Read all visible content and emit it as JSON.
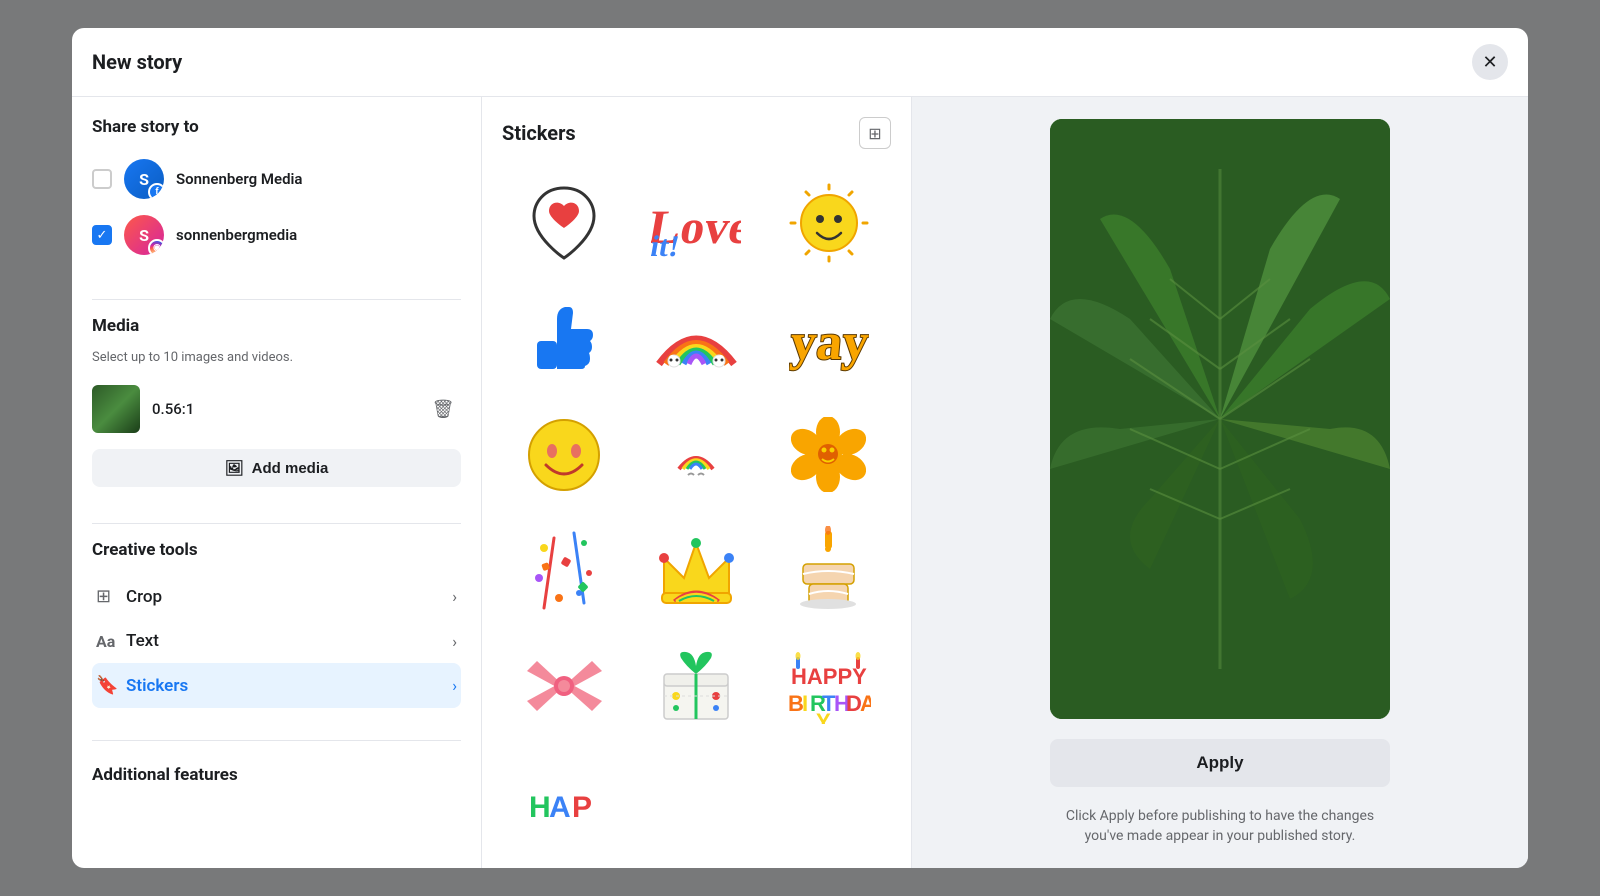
{
  "modal": {
    "title": "New story",
    "close_icon": "✕"
  },
  "share_section": {
    "label": "Share story to",
    "accounts": [
      {
        "id": "sonnenberg",
        "name": "Sonnenberg Media",
        "platform": "fb",
        "checked": false,
        "initial": "S"
      },
      {
        "id": "sonnenbergmedia",
        "name": "sonnenbergmedia",
        "platform": "ig",
        "checked": true,
        "initial": "S"
      }
    ]
  },
  "media_section": {
    "label": "Media",
    "subtitle": "Select up to 10 images and videos.",
    "ratio": "0.56:1",
    "add_media_label": "Add media"
  },
  "creative_tools": {
    "label": "Creative tools",
    "tools": [
      {
        "id": "crop",
        "icon": "crop",
        "label": "Crop",
        "active": false
      },
      {
        "id": "text",
        "icon": "text",
        "label": "Text",
        "active": false
      },
      {
        "id": "stickers",
        "icon": "sticker",
        "label": "Stickers",
        "active": true
      }
    ]
  },
  "additional": {
    "label": "Additional features"
  },
  "stickers": {
    "title": "Stickers",
    "items": [
      {
        "id": "heart-pin",
        "emoji": "📍"
      },
      {
        "id": "love-it",
        "emoji": "💕"
      },
      {
        "id": "happy-sun",
        "emoji": "☀️"
      },
      {
        "id": "thumbs-up",
        "emoji": "👍"
      },
      {
        "id": "rainbow",
        "emoji": "🌈"
      },
      {
        "id": "yay",
        "emoji": "🎉"
      },
      {
        "id": "smiley",
        "emoji": "😊"
      },
      {
        "id": "cloud-rainbow",
        "emoji": "⛅"
      },
      {
        "id": "flower",
        "emoji": "🌸"
      },
      {
        "id": "confetti",
        "emoji": "🎊"
      },
      {
        "id": "crown",
        "emoji": "👑"
      },
      {
        "id": "cake",
        "emoji": "🎂"
      },
      {
        "id": "bow",
        "emoji": "🎀"
      },
      {
        "id": "gift",
        "emoji": "🎁"
      },
      {
        "id": "happy-birthday",
        "emoji": "🎂"
      },
      {
        "id": "party",
        "emoji": "🥳"
      }
    ]
  },
  "preview": {
    "apply_label": "Apply",
    "apply_hint": "Click Apply before publishing to have the changes you've made appear in your published story."
  }
}
